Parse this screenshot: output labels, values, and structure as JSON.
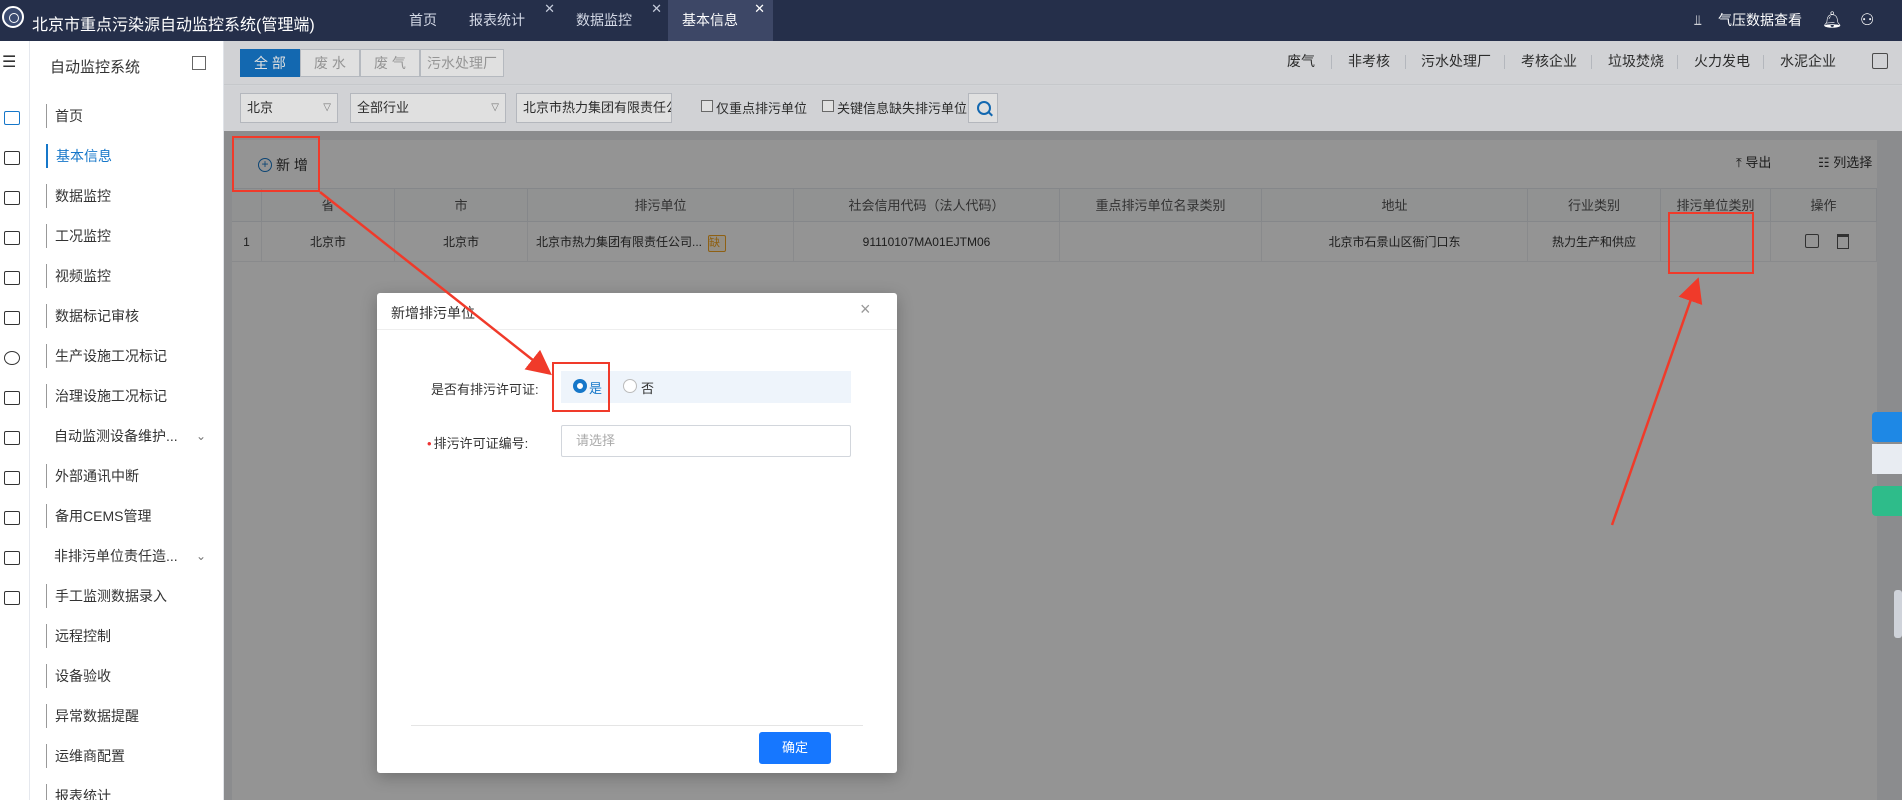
{
  "app": {
    "title": "北京市重点污染源自动监控系统(管理端)"
  },
  "tabs": [
    {
      "label": "首页",
      "closable": false
    },
    {
      "label": "报表统计",
      "closable": true
    },
    {
      "label": "数据监控",
      "closable": true
    },
    {
      "label": "基本信息",
      "closable": true,
      "active": true
    }
  ],
  "topright": {
    "pressure_label": "气压数据查看"
  },
  "sidebar": {
    "title": "自动监控系统",
    "items": [
      {
        "label": "首页"
      },
      {
        "label": "基本信息",
        "active": true
      },
      {
        "label": "数据监控"
      },
      {
        "label": "工况监控"
      },
      {
        "label": "视频监控"
      },
      {
        "label": "数据标记审核"
      },
      {
        "label": "生产设施工况标记"
      },
      {
        "label": "治理设施工况标记"
      },
      {
        "label": "自动监测设备维护...",
        "expandable": true
      },
      {
        "label": "外部通讯中断"
      },
      {
        "label": "备用CEMS管理"
      },
      {
        "label": "非排污单位责任造...",
        "expandable": true
      },
      {
        "label": "手工监测数据录入"
      },
      {
        "label": "远程控制"
      },
      {
        "label": "设备验收"
      },
      {
        "label": "异常数据提醒"
      },
      {
        "label": "运维商配置"
      },
      {
        "label": "报表统计"
      }
    ]
  },
  "filters": {
    "type_tabs": [
      "全 部",
      "废 水",
      "废 气",
      "污水处理厂"
    ],
    "right_links": [
      "废气",
      "非考核",
      "污水处理厂",
      "考核企业",
      "垃圾焚烧",
      "火力发电",
      "水泥企业"
    ],
    "region": "北京",
    "industry": "全部行业",
    "company": "北京市热力集团有限责任公司",
    "only_key_units": "仅重点排污单位",
    "missing_info": "关键信息缺失排污单位"
  },
  "toolbar": {
    "add_label": "新 增",
    "export_label": "导出",
    "colselect_label": "列选择"
  },
  "table": {
    "headers": [
      "省",
      "市",
      "排污单位",
      "社会信用代码（法人代码）",
      "重点排污单位名录类别",
      "地址",
      "行业类别",
      "排污单位类别",
      "操作"
    ],
    "rows": [
      {
        "index": "1",
        "province": "北京市",
        "city": "北京市",
        "unit": "北京市热力集团有限责任公司...",
        "badge": "缺",
        "credit": "91110107MA01EJTM06",
        "category": "",
        "address": "北京市石景山区衙门口东",
        "industry": "热力生产和供应",
        "unit_type": ""
      }
    ]
  },
  "dialog": {
    "title": "新增排污单位",
    "permit_question": "是否有排污许可证:",
    "yes": "是",
    "no": "否",
    "permit_number_label": "排污许可证编号:",
    "permit_number_placeholder": "请选择",
    "ok_label": "确定"
  },
  "colors": {
    "accent": "#1677c9",
    "topbar": "#252f4a",
    "annotation": "#f03a2a"
  }
}
